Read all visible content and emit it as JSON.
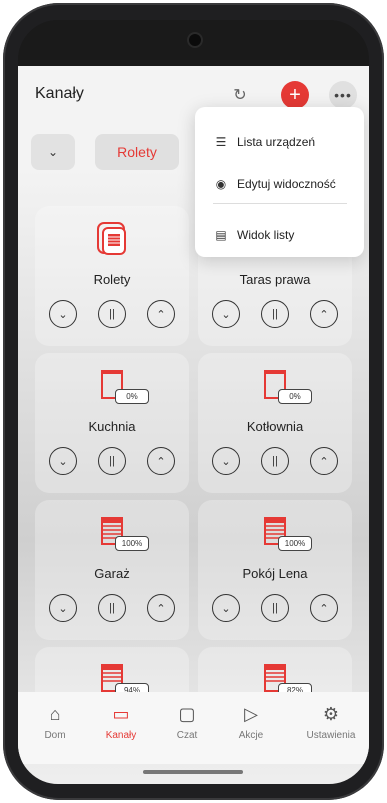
{
  "header": {
    "title": "Kanały"
  },
  "icons": {
    "refresh": "↻",
    "add": "+",
    "more": "•••",
    "chevron": "⌄"
  },
  "filter": {
    "chip_label": "Rolety"
  },
  "cards": [
    {
      "name": "Rolety",
      "badge": ""
    },
    {
      "name": "Taras prawa",
      "badge": ""
    },
    {
      "name": "Kuchnia",
      "badge": "0%"
    },
    {
      "name": "Kotłownia",
      "badge": "0%"
    },
    {
      "name": "Garaż",
      "badge": "100%"
    },
    {
      "name": "Pokój Lena",
      "badge": "100%"
    },
    {
      "name": "",
      "badge": "94%"
    },
    {
      "name": "",
      "badge": "82%"
    }
  ],
  "menu": {
    "items": [
      {
        "label": "Lista urządzeń",
        "icon": "list-icon"
      },
      {
        "label": "Edytuj widoczność",
        "icon": "eye-icon"
      },
      {
        "label": "Widok listy",
        "icon": "list-view-icon"
      }
    ]
  },
  "tabs": [
    {
      "label": "Dom",
      "icon": "home-icon"
    },
    {
      "label": "Kanały",
      "icon": "tv-icon"
    },
    {
      "label": "Czat",
      "icon": "chat-icon"
    },
    {
      "label": "Akcje",
      "icon": "play-icon"
    },
    {
      "label": "Ustawienia",
      "icon": "gear-icon"
    }
  ],
  "colors": {
    "accent": "#e53935",
    "text": "#222222"
  }
}
